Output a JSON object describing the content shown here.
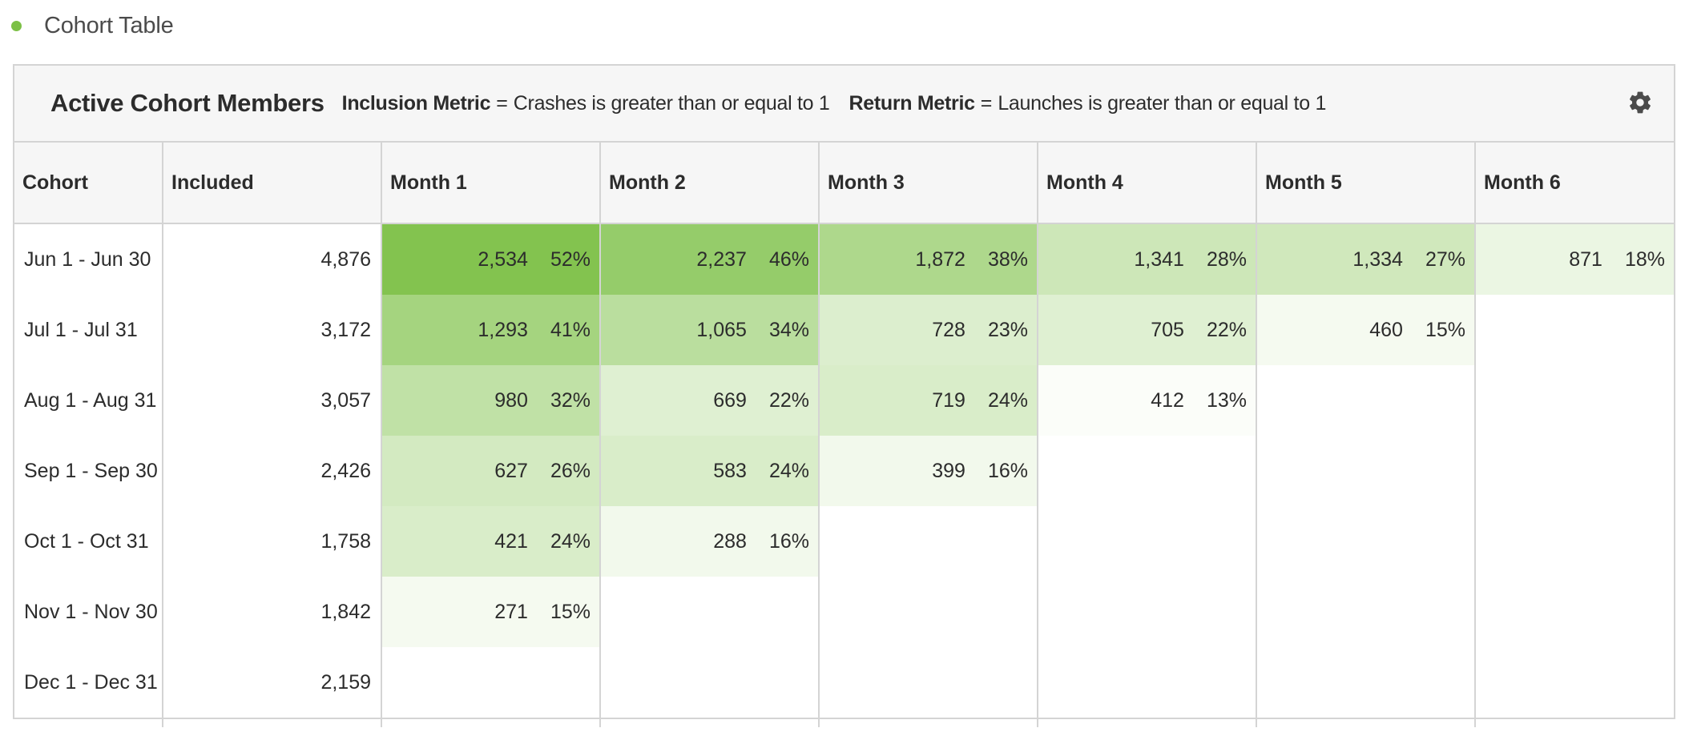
{
  "panel": {
    "title": "Cohort Table"
  },
  "card": {
    "title": "Active Cohort Members",
    "inclusion_label": "Inclusion Metric",
    "inclusion_eq": "=",
    "inclusion_value": "Crashes is greater than or equal to 1",
    "return_label": "Return Metric",
    "return_eq": "=",
    "return_value": "Launches is greater than or equal to 1",
    "settings_icon": "gear-icon"
  },
  "colors": {
    "accent_dot": "#7cc046",
    "header_bg": "#f6f6f6",
    "border": "#d4d4d4"
  },
  "table": {
    "headers": [
      "Cohort",
      "Included",
      "Month 1",
      "Month 2",
      "Month 3",
      "Month 4",
      "Month 5",
      "Month 6"
    ],
    "rows": [
      {
        "cohort": "Jun 1 - Jun 30",
        "included": "4,876",
        "months": [
          {
            "count": "2,534",
            "pct": "52%",
            "shade": 0.52
          },
          {
            "count": "2,237",
            "pct": "46%",
            "shade": 0.46
          },
          {
            "count": "1,872",
            "pct": "38%",
            "shade": 0.38
          },
          {
            "count": "1,341",
            "pct": "28%",
            "shade": 0.28
          },
          {
            "count": "1,334",
            "pct": "27%",
            "shade": 0.27
          },
          {
            "count": "871",
            "pct": "18%",
            "shade": 0.18
          }
        ]
      },
      {
        "cohort": "Jul 1 - Jul 31",
        "included": "3,172",
        "months": [
          {
            "count": "1,293",
            "pct": "41%",
            "shade": 0.41
          },
          {
            "count": "1,065",
            "pct": "34%",
            "shade": 0.34
          },
          {
            "count": "728",
            "pct": "23%",
            "shade": 0.23
          },
          {
            "count": "705",
            "pct": "22%",
            "shade": 0.22
          },
          {
            "count": "460",
            "pct": "15%",
            "shade": 0.15
          }
        ]
      },
      {
        "cohort": "Aug 1 - Aug 31",
        "included": "3,057",
        "months": [
          {
            "count": "980",
            "pct": "32%",
            "shade": 0.32
          },
          {
            "count": "669",
            "pct": "22%",
            "shade": 0.22
          },
          {
            "count": "719",
            "pct": "24%",
            "shade": 0.24
          },
          {
            "count": "412",
            "pct": "13%",
            "shade": 0.13
          }
        ]
      },
      {
        "cohort": "Sep 1 - Sep 30",
        "included": "2,426",
        "months": [
          {
            "count": "627",
            "pct": "26%",
            "shade": 0.26
          },
          {
            "count": "583",
            "pct": "24%",
            "shade": 0.24
          },
          {
            "count": "399",
            "pct": "16%",
            "shade": 0.16
          }
        ]
      },
      {
        "cohort": "Oct 1 - Oct 31",
        "included": "1,758",
        "months": [
          {
            "count": "421",
            "pct": "24%",
            "shade": 0.24
          },
          {
            "count": "288",
            "pct": "16%",
            "shade": 0.16
          }
        ]
      },
      {
        "cohort": "Nov 1 - Nov 30",
        "included": "1,842",
        "months": [
          {
            "count": "271",
            "pct": "15%",
            "shade": 0.15
          }
        ]
      },
      {
        "cohort": "Dec 1 - Dec 31",
        "included": "2,159",
        "months": []
      }
    ]
  }
}
